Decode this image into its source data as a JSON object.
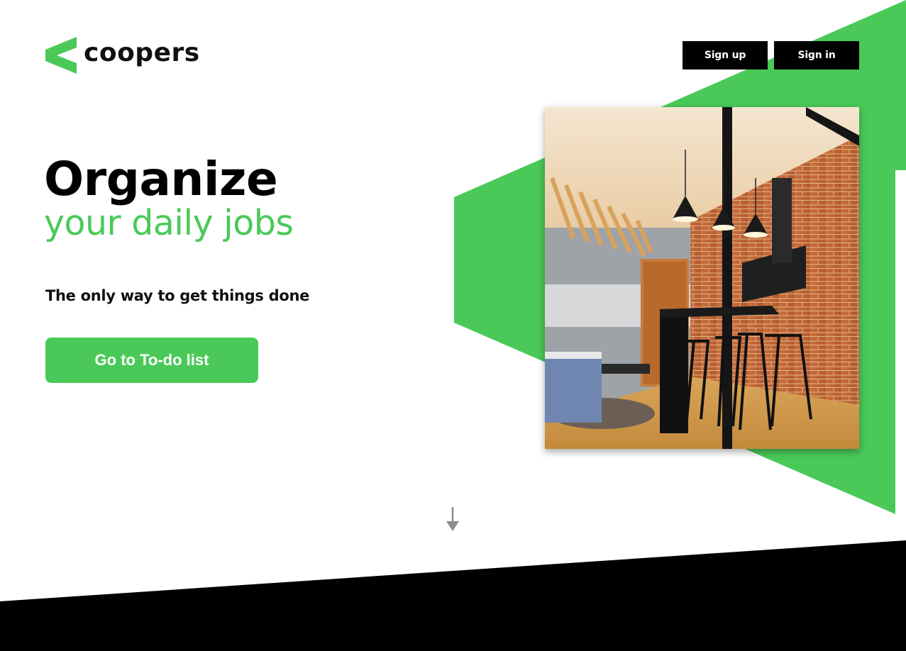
{
  "brand": {
    "name": "coopers",
    "logo_icon": "chevron-left-logo-icon",
    "accent_color": "#4ac959"
  },
  "header": {
    "signup_label": "Sign up",
    "signin_label": "Sign in"
  },
  "hero": {
    "title": "Organize",
    "subtitle": "your daily jobs",
    "tagline": "The only way to get things done",
    "cta_label": "Go to To-do list",
    "photo": "office-interior-photo"
  },
  "scroll": {
    "icon": "arrow-down-icon"
  }
}
